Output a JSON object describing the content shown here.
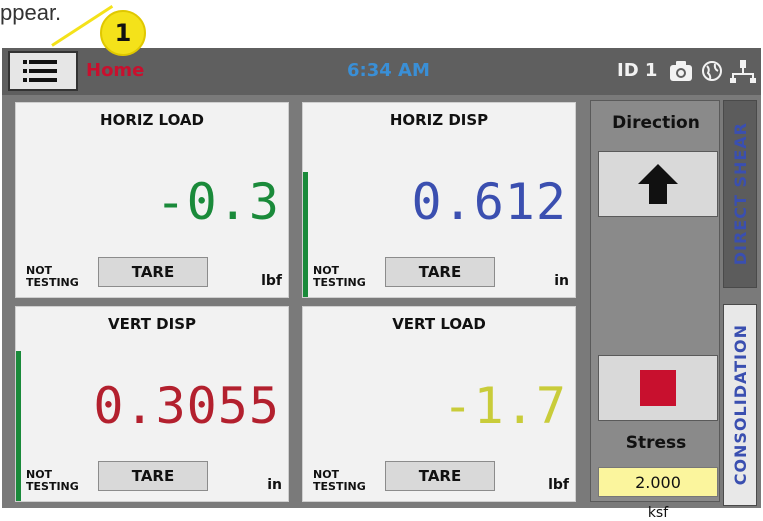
{
  "caption": "ppear.",
  "callout": {
    "number": "1"
  },
  "header": {
    "menu_icon": "hamburger-menu-icon",
    "home_label": "Home",
    "time": "6:34 AM",
    "id_label": "ID 1",
    "icons": [
      "camera-icon",
      "globe-icon",
      "network-icon"
    ]
  },
  "panels": [
    {
      "title": "HORIZ LOAD",
      "value": "-0.3",
      "value_color": "#1a8a3a",
      "status": "NOT TESTING",
      "tare_label": "TARE",
      "unit": "lbf"
    },
    {
      "title": "HORIZ DISP",
      "value": "0.612",
      "value_color": "#3b4fb0",
      "status": "NOT TESTING",
      "tare_label": "TARE",
      "unit": "in"
    },
    {
      "title": "VERT DISP",
      "value": "0.3055",
      "value_color": "#b3202e",
      "status": "NOT TESTING",
      "tare_label": "TARE",
      "unit": "in"
    },
    {
      "title": "VERT LOAD",
      "value": "-1.7",
      "value_color": "#c9cc3a",
      "status": "NOT TESTING",
      "tare_label": "TARE",
      "unit": "lbf"
    }
  ],
  "sidepanel": {
    "direction_title": "Direction",
    "direction_icon": "arrow-up-icon",
    "stop_icon": "stop-icon",
    "stress_label": "Stress",
    "stress_value": "2.000",
    "stress_unit": "ksf"
  },
  "tabs": {
    "direct_shear": "DIRECT SHEAR",
    "consolidation": "CONSOLIDATION"
  }
}
